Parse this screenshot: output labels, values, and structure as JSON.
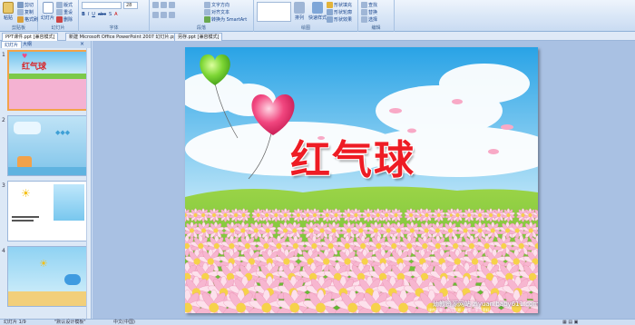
{
  "ribbon": {
    "groups": [
      {
        "label": "剪贴板",
        "buttons": [
          "粘贴",
          "剪切",
          "复制",
          "格式刷"
        ]
      },
      {
        "label": "幻灯片",
        "buttons": [
          "新建",
          "幻灯片",
          "版式",
          "重设",
          "删除"
        ]
      },
      {
        "label": "字体",
        "font_value": "",
        "size_value": "28"
      },
      {
        "label": "段落",
        "buttons": [
          "文字方向",
          "对齐文本",
          "转换为 SmartArt"
        ]
      },
      {
        "label": "绘图",
        "buttons": [
          "排列",
          "快速样式",
          "形状填充",
          "形状轮廓",
          "形状效果"
        ]
      },
      {
        "label": "编辑",
        "buttons": [
          "查找",
          "替换",
          "选择"
        ]
      }
    ]
  },
  "doc_tabs": [
    "PPT课件.ppt [兼容模式]",
    "新建 Microsoft Office PowerPoint 2007 幻灯片.ppt",
    "另存.ppt [兼容模式]"
  ],
  "panel_tabs": [
    "幻灯片",
    "大纲"
  ],
  "thumbnails": [
    {
      "num": "1",
      "title": "红气球"
    },
    {
      "num": "2",
      "title": ""
    },
    {
      "num": "3",
      "title": ""
    },
    {
      "num": "4",
      "title": ""
    }
  ],
  "slide": {
    "title": "红气球",
    "watermark": "幼教资源网站 ziyuan.baby611.com",
    "watermark_small": "课件下载 · 幼儿资源 · 教案 · 学习资料"
  },
  "status": {
    "slide_info": "幻灯片 1/9",
    "theme": "\"默认设计模板\"",
    "language": "中文(中国)"
  },
  "colors": {
    "title": "#ee1c24",
    "ribbon": "#d7e5f6",
    "editor_bg": "#a9c1e3",
    "selection": "#f2a34a"
  }
}
